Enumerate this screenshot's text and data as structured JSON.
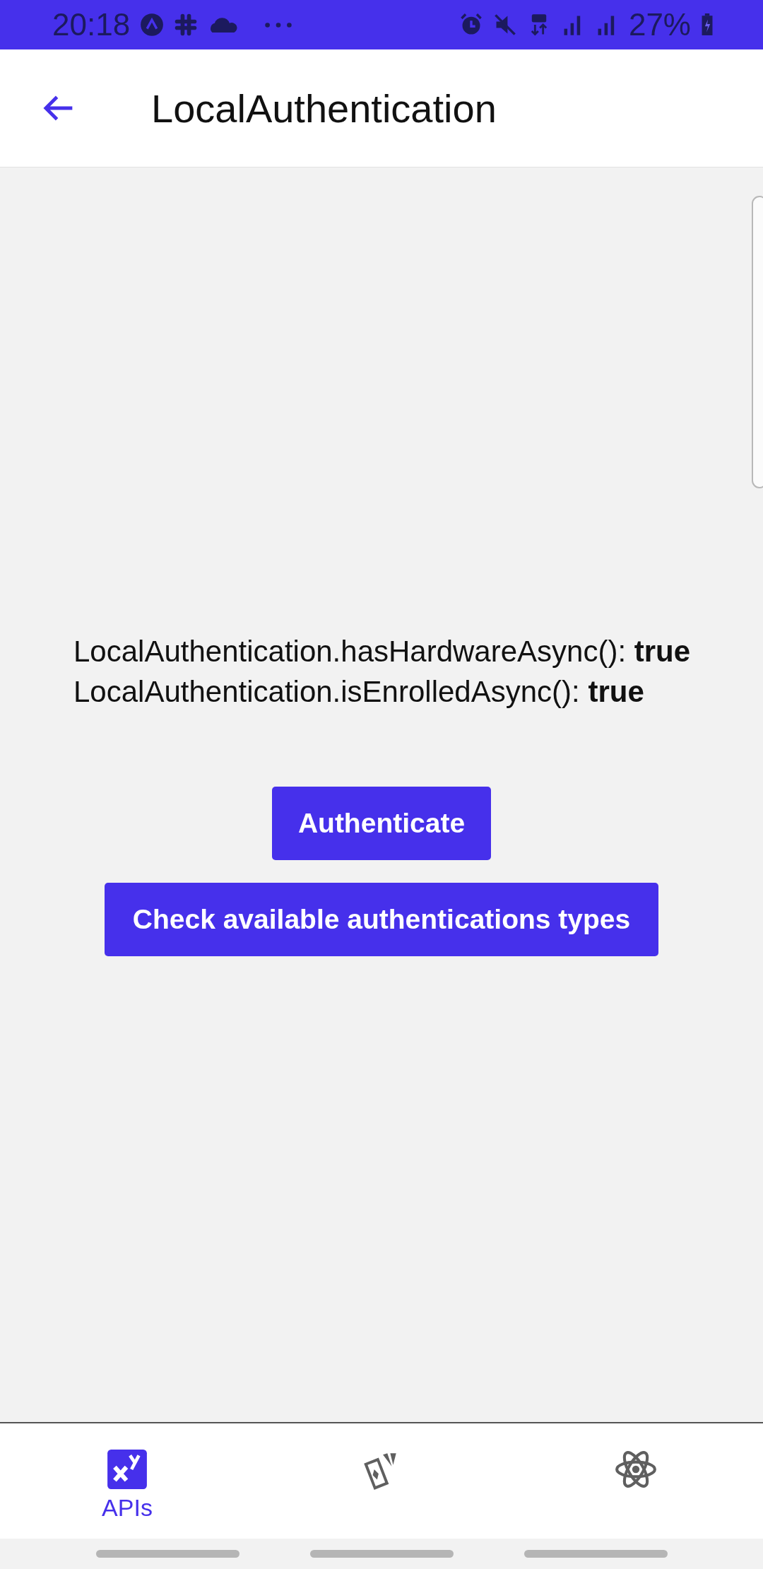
{
  "status_bar": {
    "time": "20:18",
    "battery": "27%"
  },
  "header": {
    "title": "LocalAuthentication"
  },
  "results": [
    "LocalAuthentication.hasHardwareAsync(): **true**",
    "LocalAuthentication.isEnrolledAsync(): **true**"
  ],
  "buttons": [
    "Authenticate",
    "Check available authentications types"
  ],
  "tab_bar": [
    {
      "kind": "apis",
      "label": "APIs",
      "selected": true
    },
    {
      "kind": "cards",
      "selected": false
    },
    {
      "kind": "atom",
      "selected": false
    }
  ]
}
